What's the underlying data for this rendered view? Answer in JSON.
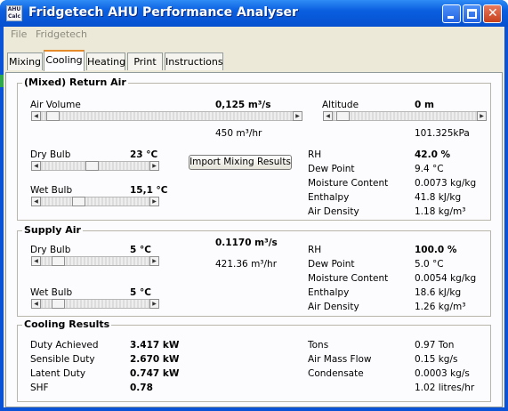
{
  "window": {
    "title": "Fridgetech AHU Performance Analyser",
    "icon_text": "AHU Calc"
  },
  "menu": [
    "File",
    "Fridgetech"
  ],
  "tabs": [
    "Mixing",
    "Cooling",
    "Heating",
    "Print",
    "Instructions"
  ],
  "active_tab": "Cooling",
  "return_air": {
    "title": "(Mixed) Return Air",
    "air_volume_label": "Air Volume",
    "air_volume_value": "0,125 m³/s",
    "air_volume_alt": "450 m³/hr",
    "altitude_label": "Altitude",
    "altitude_value": "0 m",
    "pressure": "101.325kPa",
    "dry_bulb_label": "Dry Bulb",
    "dry_bulb_value": "23 °C",
    "wet_bulb_label": "Wet Bulb",
    "wet_bulb_value": "15,1 °C",
    "import_button": "Import Mixing Results",
    "props": [
      {
        "label": "RH",
        "value": "42.0 %",
        "bold": true
      },
      {
        "label": "Dew Point",
        "value": "9.4 °C"
      },
      {
        "label": "Moisture Content",
        "value": "0.0073 kg/kg"
      },
      {
        "label": "Enthalpy",
        "value": "41.8 kJ/kg"
      },
      {
        "label": "Air Density",
        "value": "1.18 kg/m³"
      }
    ]
  },
  "supply_air": {
    "title": "Supply Air",
    "dry_bulb_label": "Dry Bulb",
    "dry_bulb_value": "5 °C",
    "wet_bulb_label": "Wet Bulb",
    "wet_bulb_value": "5 °C",
    "flow_m3s": "0.1170 m³/s",
    "flow_m3hr": "421.36 m³/hr",
    "props": [
      {
        "label": "RH",
        "value": "100.0 %",
        "bold": true
      },
      {
        "label": "Dew Point",
        "value": "5.0 °C"
      },
      {
        "label": "Moisture Content",
        "value": "0.0054 kg/kg"
      },
      {
        "label": "Enthalpy",
        "value": "18.6 kJ/kg"
      },
      {
        "label": "Air Density",
        "value": "1.26 kg/m³"
      }
    ]
  },
  "cooling_results": {
    "title": "Cooling Results",
    "left": [
      {
        "label": "Duty Achieved",
        "value": "3.417 kW"
      },
      {
        "label": "Sensible Duty",
        "value": "2.670 kW"
      },
      {
        "label": "Latent Duty",
        "value": "0.747 kW"
      },
      {
        "label": "SHF",
        "value": "0.78"
      }
    ],
    "right": [
      {
        "label": "Tons",
        "value": "0.97 Ton"
      },
      {
        "label": "Air Mass Flow",
        "value": "0.15 kg/s"
      },
      {
        "label": "Condensate",
        "value": "0.0003 kg/s"
      },
      {
        "label": "",
        "value": "1.02 litres/hr"
      }
    ]
  },
  "colors": {
    "title_bar": "#0a5fe0",
    "panel": "#fcfcfe",
    "client": "#ece9d8",
    "tab_accent": "#e68b2c"
  }
}
